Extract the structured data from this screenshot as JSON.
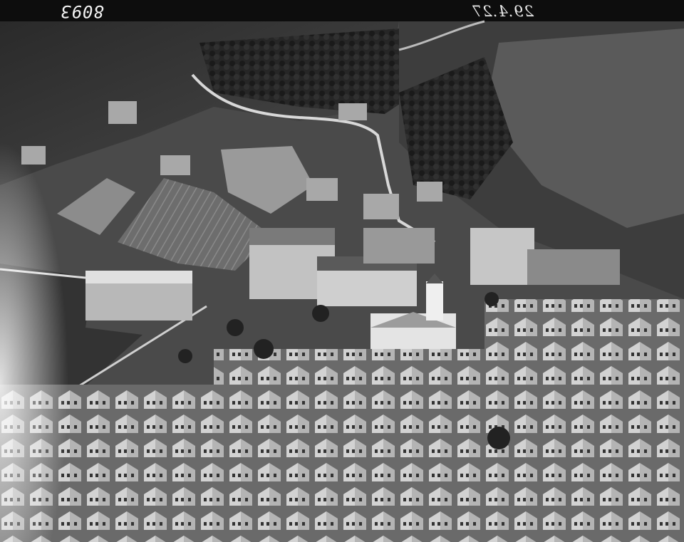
{
  "photo": {
    "subject": "aerial-village-photograph",
    "plate_number": "8093",
    "plate_date": "29.4.27",
    "tones": {
      "sky_band": "#0d0d0d",
      "meadow_light": "#8c8c8c",
      "meadow_dark": "#3c3c3c",
      "forest": "#1e1e1e",
      "roof_light": "#bdbdbd",
      "roof_dark": "#555555",
      "road": "#d8d8d8"
    }
  }
}
